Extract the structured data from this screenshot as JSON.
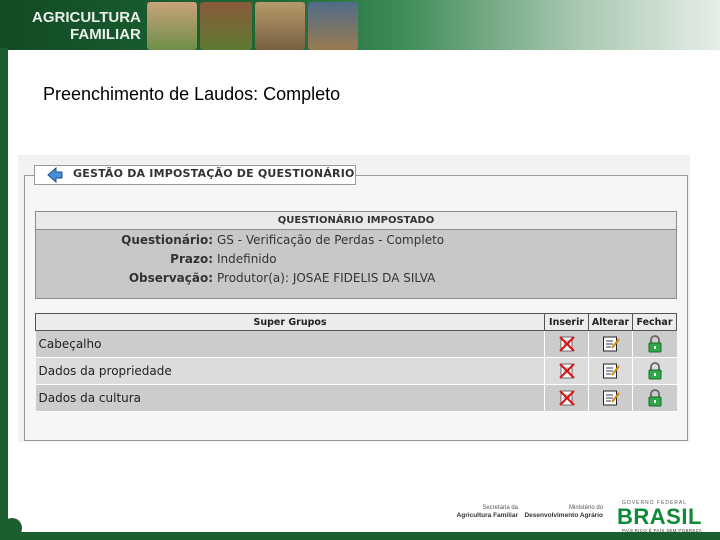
{
  "banner": {
    "logo_line1": "AGRICULTURA",
    "logo_line2": "FAMILIAR"
  },
  "slide_title": "Preenchimento de Laudos: Completo",
  "panel": {
    "tab_title": "GESTÃO DA IMPOSTAÇÃO DE QUESTIONÁRIO",
    "questionnaire": {
      "header": "QUESTIONÁRIO IMPOSTADO",
      "rows": [
        {
          "label": "Questionário:",
          "value": "GS - Verificação de Perdas - Completo"
        },
        {
          "label": "Prazo:",
          "value": "Indefinido"
        },
        {
          "label": "Observação:",
          "value": "Produtor(a): JOSAE FIDELIS DA SILVA"
        }
      ]
    },
    "super_groups": {
      "headers": {
        "name": "Super Grupos",
        "insert": "Inserir",
        "edit": "Alterar",
        "close": "Fechar"
      },
      "rows": [
        {
          "name": "Cabeçalho"
        },
        {
          "name": "Dados da propriedade"
        },
        {
          "name": "Dados da cultura"
        }
      ]
    }
  },
  "footer": {
    "sec_small": "Secretaria da",
    "sec_bold": "Agricultura Familiar",
    "min_small": "Ministério do",
    "min_bold": "Desenvolvimento Agrário",
    "gov_top": "GOVERNO FEDERAL",
    "gov_name": "BRASIL",
    "gov_sub": "PAÍS RICO É PAÍS SEM POBREZA"
  },
  "colors": {
    "brand_green": "#1d5e30",
    "brasil_green": "#0f8a36",
    "lock_green": "#2fa84a"
  },
  "icons": {
    "back": "back-arrow-icon",
    "insert": "insert-disabled-icon",
    "edit": "edit-document-icon",
    "close": "lock-icon"
  }
}
